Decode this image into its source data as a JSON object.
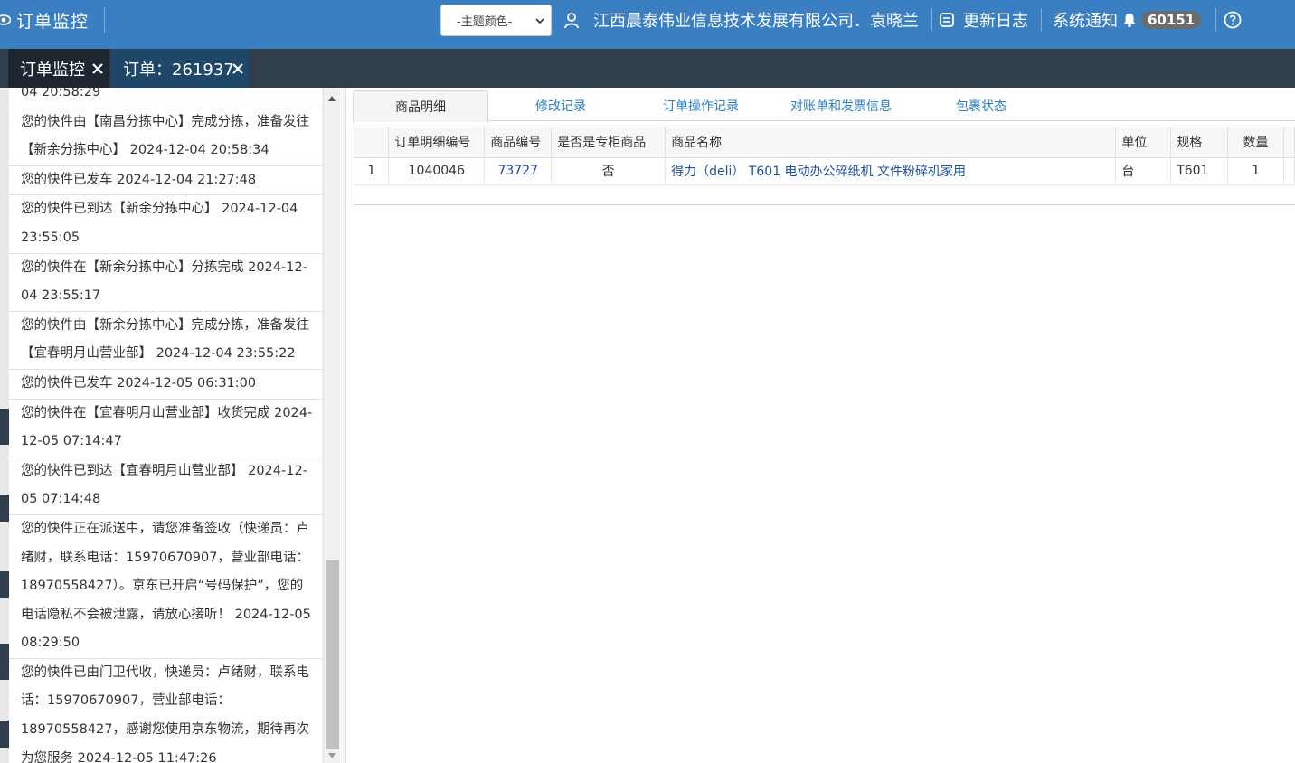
{
  "header": {
    "app_title": "订单监控",
    "theme_select": "-主题颜色-",
    "user": "江西晨泰伟业信息技术发展有限公司．袁晓兰",
    "changelog": "更新日志",
    "notifications": "系统通知",
    "notification_count": "60151",
    "help_icon": "help-circle-icon"
  },
  "tabs": [
    {
      "label": "订单监控"
    },
    {
      "label": "订单：261937"
    }
  ],
  "tracking": [
    "04 20:58:29",
    "您的快件由【南昌分拣中心】完成分拣，准备发往【新余分拣中心】 2024-12-04 20:58:34",
    "您的快件已发车 2024-12-04 21:27:48",
    "您的快件已到达【新余分拣中心】 2024-12-04 23:55:05",
    "您的快件在【新余分拣中心】分拣完成 2024-12-04 23:55:17",
    "您的快件由【新余分拣中心】完成分拣，准备发往【宜春明月山营业部】 2024-12-04 23:55:22",
    "您的快件已发车 2024-12-05 06:31:00",
    "您的快件在【宜春明月山营业部】收货完成 2024-12-05 07:14:47",
    "您的快件已到达【宜春明月山营业部】 2024-12-05 07:14:48",
    "您的快件正在派送中，请您准备签收（快递员：卢绪财，联系电话：15970670907，营业部电话：18970558427）。京东已开启“号码保护”，您的电话隐私不会被泄露，请放心接听！ 2024-12-05 08:29:50",
    "您的快件已由门卫代收，快递员：卢绪财，联系电话：15970670907，营业部电话：18970558427，感谢您使用京东物流，期待再次为您服务 2024-12-05 11:47:26"
  ],
  "subtabs": [
    "商品明细",
    "修改记录",
    "订单操作记录",
    "对账单和发票信息",
    "包裹状态"
  ],
  "table": {
    "headers": [
      "",
      "订单明细编号",
      "商品编号",
      "是否是专柜商品",
      "商品名称",
      "单位",
      "规格",
      "数量"
    ],
    "rows": [
      [
        "1",
        "1040046",
        "73727",
        "否",
        "得力（deli） T601 电动办公碎纸机 文件粉碎机家用",
        "台",
        "T601",
        "1"
      ]
    ]
  }
}
